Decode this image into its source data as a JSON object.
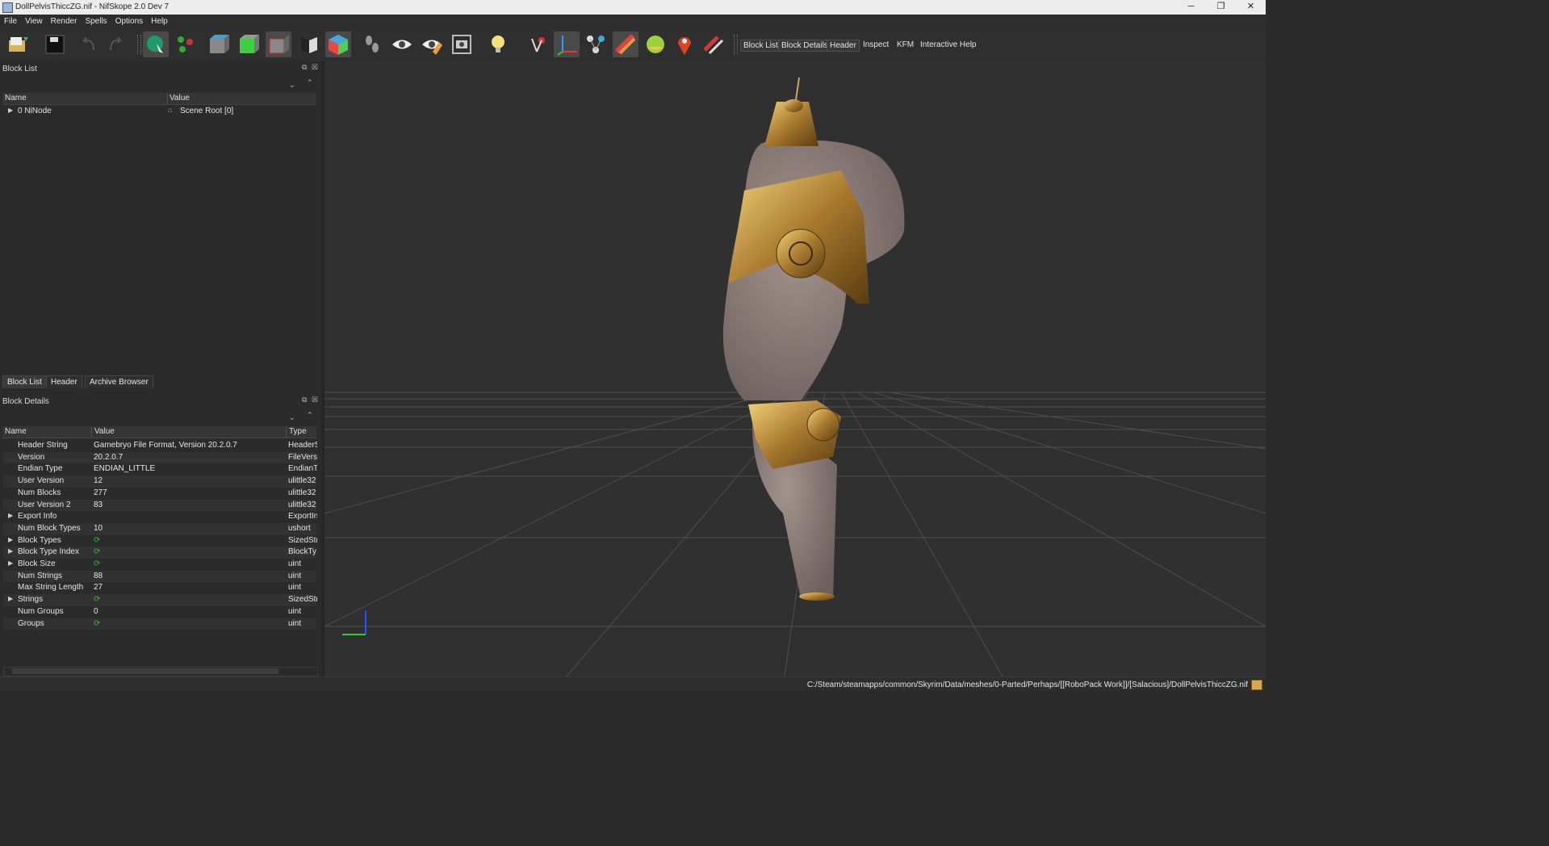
{
  "window": {
    "title": "DollPelvisThiccZG.nif - NifSkope 2.0 Dev 7",
    "controls": [
      "─",
      "❐",
      "✕"
    ]
  },
  "menu": [
    "File",
    "View",
    "Render",
    "Spells",
    "Options",
    "Help"
  ],
  "toolbar": {
    "text_buttons": [
      "Block List",
      "Block Details",
      "Header",
      "Inspect",
      "KFM",
      "Interactive Help"
    ]
  },
  "block_list": {
    "title": "Block List",
    "columns": [
      "Name",
      "Value"
    ],
    "rows": [
      {
        "name": "0 NiNode",
        "value": "Scene Root [0]"
      }
    ]
  },
  "tabs": [
    "Block List",
    "Header",
    "Archive Browser"
  ],
  "block_details": {
    "title": "Block Details",
    "columns": [
      "Name",
      "Value",
      "Type"
    ],
    "rows": [
      {
        "name": "Header String",
        "value": "Gamebryo File Format, Version 20.2.0.7",
        "type": "HeaderS",
        "expand": false
      },
      {
        "name": "Version",
        "value": "20.2.0.7",
        "type": "FileVersi",
        "expand": false
      },
      {
        "name": "Endian Type",
        "value": "ENDIAN_LITTLE",
        "type": "EndianT",
        "expand": false
      },
      {
        "name": "User Version",
        "value": "12",
        "type": "ulittle32",
        "expand": false
      },
      {
        "name": "Num Blocks",
        "value": "277",
        "type": "ulittle32",
        "expand": false
      },
      {
        "name": "User Version 2",
        "value": "83",
        "type": "ulittle32",
        "expand": false
      },
      {
        "name": "Export Info",
        "value": "",
        "type": "ExportIn",
        "expand": true
      },
      {
        "name": "Num Block Types",
        "value": "10",
        "type": "ushort",
        "expand": false
      },
      {
        "name": "Block Types",
        "value": "",
        "type": "SizedStri",
        "expand": true,
        "refresh": true
      },
      {
        "name": "Block Type Index",
        "value": "",
        "type": "BlockTy",
        "expand": true,
        "refresh": true
      },
      {
        "name": "Block Size",
        "value": "",
        "type": "uint",
        "expand": true,
        "refresh": true
      },
      {
        "name": "Num Strings",
        "value": "88",
        "type": "uint",
        "expand": false
      },
      {
        "name": "Max String Length",
        "value": "27",
        "type": "uint",
        "expand": false
      },
      {
        "name": "Strings",
        "value": "",
        "type": "SizedStri",
        "expand": true,
        "refresh": true
      },
      {
        "name": "Num Groups",
        "value": "0",
        "type": "uint",
        "expand": false
      },
      {
        "name": "Groups",
        "value": "",
        "type": "uint",
        "expand": false,
        "refresh": true
      }
    ]
  },
  "status": {
    "path": "C:/Steam/steamapps/common/Skyrim/Data/meshes/0-Parted/Perhaps/[[RoboPack Work]]/[Salacious]/DollPelvisThiccZG.nif"
  },
  "colors": {
    "background": "#2b2b2b",
    "viewport": "#303030",
    "gold": "#b8923a",
    "skin": "#8e7e7a"
  }
}
